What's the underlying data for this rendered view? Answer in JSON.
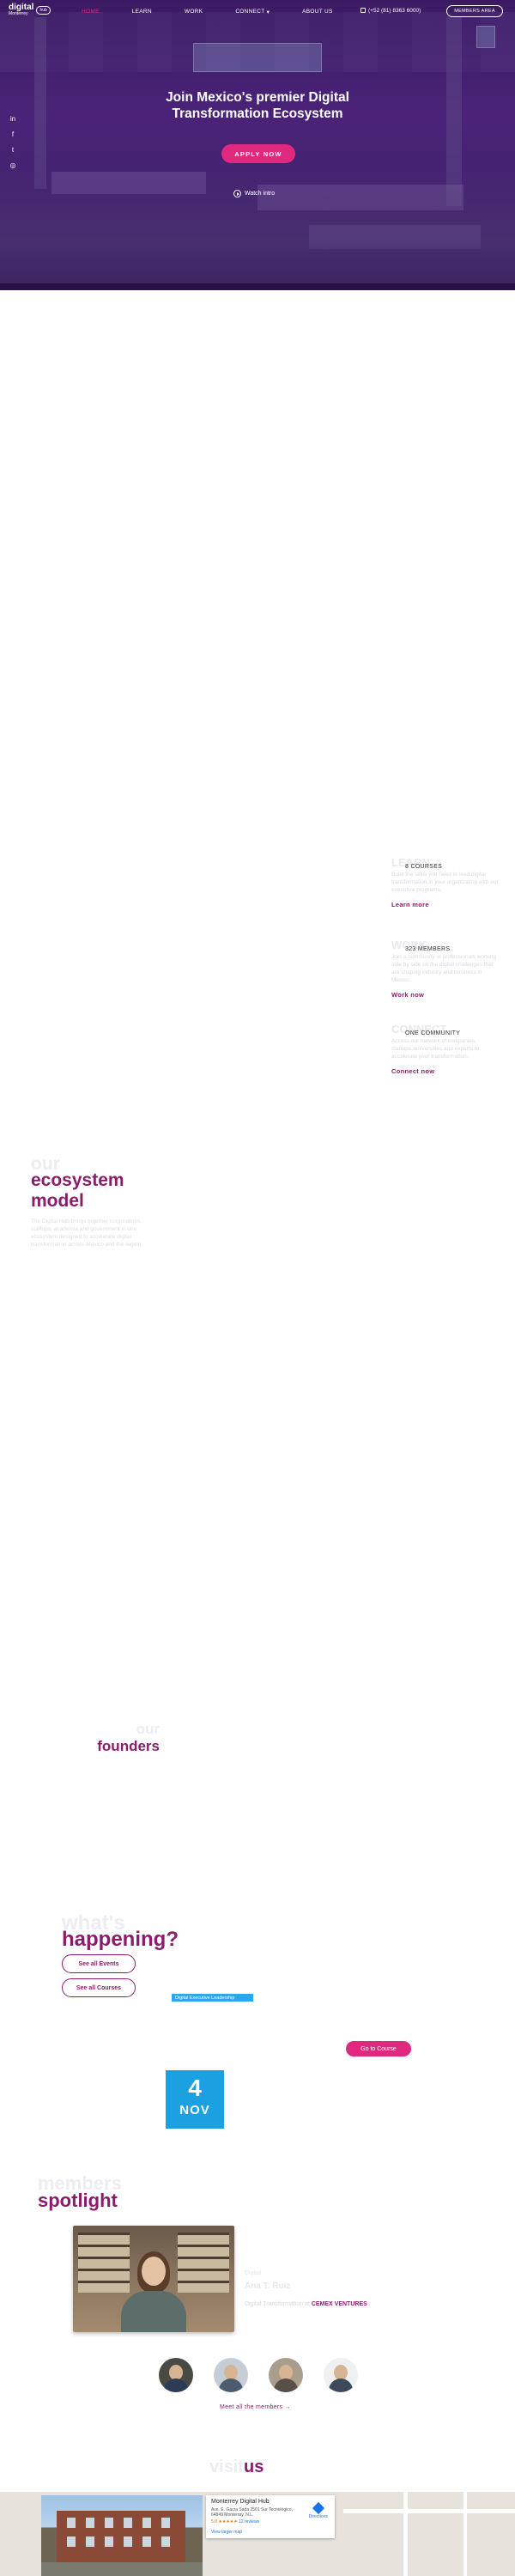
{
  "header": {
    "logo_word1": "digital",
    "logo_word2": "Monterrey",
    "logo_hub": "hub",
    "nav": [
      "HOME",
      "LEARN",
      "WORK",
      "CONNECT",
      "ABOUT US"
    ],
    "connect_caret": "▾",
    "phone": "(+52 (81) 8363 6000)",
    "members_area": "MEMBERS AREA"
  },
  "social": [
    "in",
    "f",
    "t",
    "◎"
  ],
  "hero": {
    "title": "Join Mexico's premier Digital Transformation Ecosystem",
    "apply": "APPLY NOW",
    "watch": "Watch intro"
  },
  "pillars": [
    {
      "ghost": "LEARN",
      "count": "8 COURSES",
      "text": "Build the skills you need to lead digital transformation in your organization with our executive programs.",
      "cta": "Learn more"
    },
    {
      "ghost": "WORK",
      "count": "323 MEMBERS",
      "text": "Join a community of professionals working side by side on the digital challenges that are shaping industry and business in Mexico.",
      "cta": "Work now"
    },
    {
      "ghost": "CONNECT",
      "count": "ONE COMMUNITY",
      "text": "Access our network of companies, startups, universities and experts to accelerate your transformation.",
      "cta": "Connect now"
    }
  ],
  "ecosystem": {
    "ghost": "our",
    "title": "ecosystem model",
    "text": "The Digital Hub brings together corporations, startups, academia and government in one ecosystem designed to accelerate digital transformation across Mexico and the region."
  },
  "founders": {
    "ghost": "our",
    "title": "founders"
  },
  "happening": {
    "ghost": "what's",
    "title": "happening?",
    "events_btn": "See all Events",
    "courses_btn": "See all Courses",
    "tag": "Digital Executive Leadership",
    "go_course": "Go to Course",
    "day": "4",
    "month": "NOV"
  },
  "members": {
    "ghost": "members",
    "title": "spotlight",
    "label": "Digital",
    "name": "Ana T. Ruiz",
    "role_prefix": "Digital Transformation at",
    "company": "CEMEX VENTURES",
    "meet": "Meet all the members →"
  },
  "visit": {
    "a": "visit",
    "b": "us",
    "place": "Monterrey Digital Hub",
    "address": "Ave. E. Garza Sada 2501 Sur Tecnológico, 64849 Monterrey, N.L.",
    "rating": "5.0 ★★★★★",
    "reviews": "12 reviews",
    "directions": "Directions",
    "larger": "View larger map"
  },
  "colors": {
    "primary": "#8a1d6b",
    "accent": "#e0287f",
    "blue": "#1ba0e2",
    "hero": "#4a2378"
  }
}
